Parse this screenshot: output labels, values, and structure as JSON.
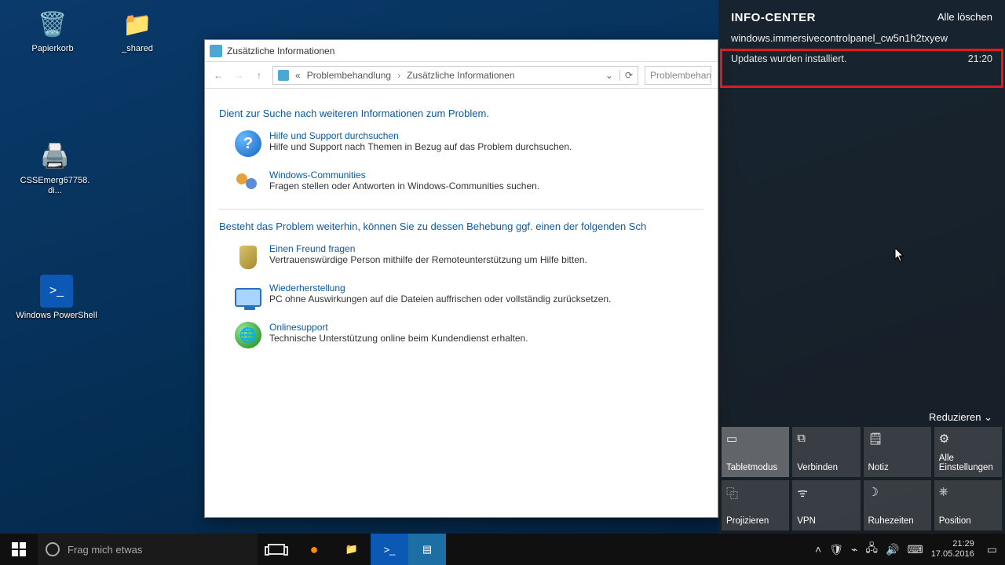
{
  "desktop": {
    "icons": [
      {
        "label": "Papierkorb"
      },
      {
        "label": "_shared"
      },
      {
        "label": "CSSEmerg67758. di..."
      },
      {
        "label": "Windows PowerShell"
      }
    ]
  },
  "window": {
    "title": "Zusätzliche Informationen",
    "breadcrumb": {
      "prefix": "«",
      "a": "Problembehandlung",
      "b": "Zusätzliche Informationen"
    },
    "search_placeholder": "Problembehand",
    "heading1": "Dient zur Suche nach weiteren Informationen zum Problem.",
    "heading2": "Besteht das Problem weiterhin, können Sie zu dessen Behebung ggf. einen der folgenden Sch",
    "items1": [
      {
        "link": "Hilfe und Support durchsuchen",
        "desc": "Hilfe und Support nach Themen in Bezug auf das Problem durchsuchen."
      },
      {
        "link": "Windows-Communities",
        "desc": "Fragen stellen oder Antworten in Windows-Communities suchen."
      }
    ],
    "items2": [
      {
        "link": "Einen Freund fragen",
        "desc": "Vertrauenswürdige Person mithilfe der Remoteunterstützung um Hilfe bitten."
      },
      {
        "link": "Wiederherstellung",
        "desc": "PC ohne Auswirkungen auf die Dateien auffrischen oder vollständig zurücksetzen."
      },
      {
        "link": "Onlinesupport",
        "desc": "Technische Unterstützung online beim Kundendienst erhalten."
      }
    ]
  },
  "action_center": {
    "title": "INFO-CENTER",
    "clear_all": "Alle löschen",
    "group_app": "windows.immersivecontrolpanel_cw5n1h2txyew",
    "notification": {
      "text": "Updates wurden installiert.",
      "time": "21:20"
    },
    "reduce": "Reduzieren",
    "tiles": [
      {
        "label": "Tabletmodus",
        "on": true
      },
      {
        "label": "Verbinden"
      },
      {
        "label": "Notiz"
      },
      {
        "label": "Alle Einstellungen"
      },
      {
        "label": "Projizieren"
      },
      {
        "label": "VPN"
      },
      {
        "label": "Ruhezeiten"
      },
      {
        "label": "Position"
      }
    ]
  },
  "taskbar": {
    "search_placeholder": "Frag mich etwas",
    "clock_time": "21:29",
    "clock_date": "17.05.2016"
  }
}
